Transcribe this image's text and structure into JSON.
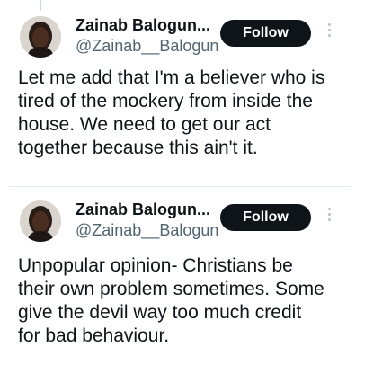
{
  "tweets": [
    {
      "author_name": "Zainab Balogun...",
      "author_handle": "@Zainab__Balogun",
      "follow_label": "Follow",
      "text": "Let me add that I'm a believer who is tired of the mockery from inside the house. We need to get our act together because this ain't it."
    },
    {
      "author_name": "Zainab Balogun...",
      "author_handle": "@Zainab__Balogun",
      "follow_label": "Follow",
      "text": "Unpopular opinion- Christians be their own problem sometimes. Some give the devil way too much credit for bad behaviour."
    }
  ],
  "icons": {
    "more": "more-vertical-icon",
    "avatar": "avatar-photo"
  },
  "colors": {
    "follow_button_bg": "#0f1419",
    "handle_text": "#536471",
    "divider": "#e1e6ea"
  }
}
